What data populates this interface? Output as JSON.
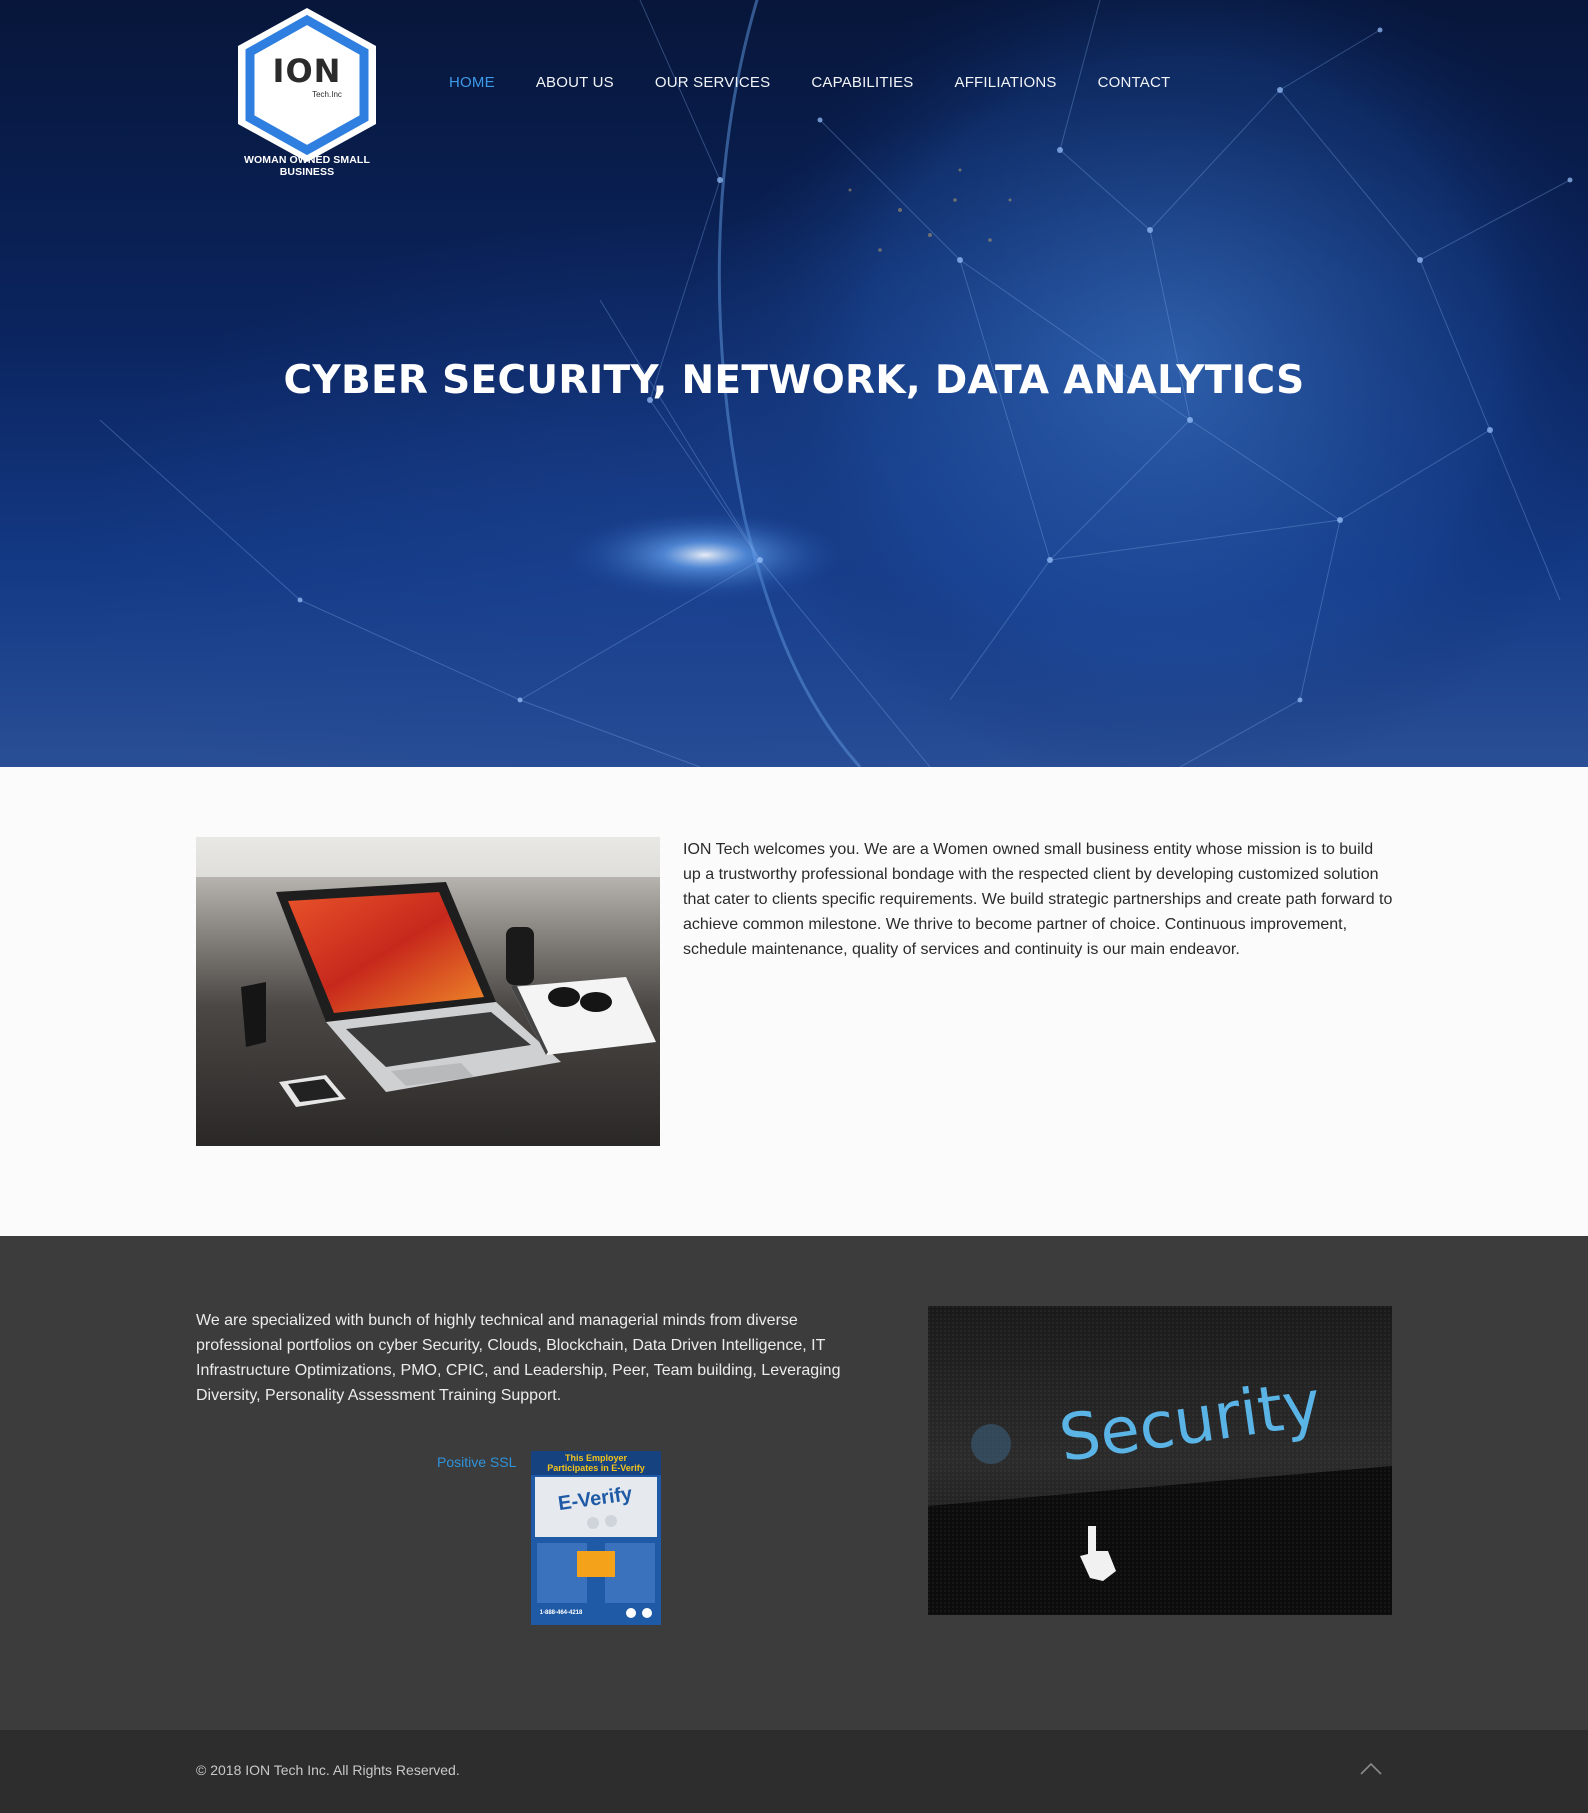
{
  "header": {
    "logo": {
      "text": "ION",
      "subtext": "Tech.Inc",
      "tagline": "WOMAN OWNED SMALL BUSINESS"
    },
    "nav": [
      {
        "label": "HOME",
        "active": true
      },
      {
        "label": "ABOUT US",
        "active": false
      },
      {
        "label": "OUR SERVICES",
        "active": false
      },
      {
        "label": "CAPABILITIES",
        "active": false
      },
      {
        "label": "AFFILIATIONS",
        "active": false
      },
      {
        "label": "CONTACT",
        "active": false
      }
    ]
  },
  "hero": {
    "headline": "CYBER SECURITY, NETWORK, DATA ANALYTICS"
  },
  "welcome": {
    "text": "ION Tech welcomes you. We are a Women owned small business entity whose mission is to build up a trustworthy professional bondage with the respected client by developing customized solution that cater to clients specific requirements. We build strategic partnerships and create path forward to achieve common milestone. We thrive to become partner of choice. Continuous improvement, schedule maintenance, quality of services and continuity is our main endeavor."
  },
  "specialized": {
    "text": "We are specialized with bunch of highly technical and managerial minds from diverse professional portfolios on cyber Security, Clouds, Blockchain, Data Driven Intelligence, IT Infrastructure Optimizations, PMO, CPIC, and Leadership, Peer, Team building, Leveraging Diversity, Personality Assessment Training Support.",
    "ssl_link": "Positive SSL",
    "everify": {
      "title": "This Employer Participates in E-Verify",
      "brand": "E-Verify",
      "phone": "1-888-464-4218"
    },
    "security_image_text": "Security"
  },
  "footer": {
    "copyright": "© 2018 ION Tech Inc. All Rights Reserved."
  },
  "colors": {
    "accent": "#3d9ae8",
    "link": "#2e93db",
    "dark_section": "#3c3c3c",
    "footer": "#2d2d2d"
  }
}
